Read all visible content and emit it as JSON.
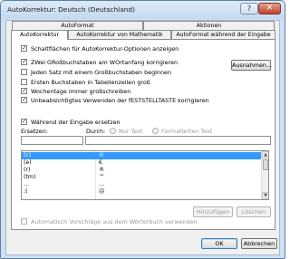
{
  "window": {
    "title": "AutoKorrektur: Deutsch (Deutschland)",
    "help_glyph": "?",
    "close_glyph": "✕"
  },
  "tabs": {
    "row1": [
      "AutoFormat",
      "Aktionen"
    ],
    "row2": [
      "AutoKorrektur",
      "AutoKorrektur von Mathematik",
      "AutoFormat während der Eingabe"
    ],
    "active": "AutoKorrektur"
  },
  "options": [
    {
      "label": "Schaltflächen für AutoKorrektur-Optionen anzeigen",
      "checked": true
    },
    {
      "label": "ZWei GRoßbuchstaben am WOrtanfang korrigieren",
      "checked": true
    },
    {
      "label": "Jeden Satz mit einem Großbuchstaben beginnen",
      "checked": false
    },
    {
      "label": "Ersten Buchstaben in Tabellenzellen groß",
      "checked": false
    },
    {
      "label": "Wochentage immer großschreiben",
      "checked": true
    },
    {
      "label": "Unbeabsichtigtes Verwenden der fESTSTELLTASTE korrigieren",
      "checked": true
    }
  ],
  "exceptions_button": "Ausnahmen...",
  "replace": {
    "label": "Während der Eingabe ersetzen",
    "checked": true,
    "replace_label": "Ersetzen:",
    "with_label": "Durch:",
    "plain_text": "Nur Text",
    "formatted_text": "Formatierten Text",
    "replace_value": "",
    "with_value": ""
  },
  "list": [
    {
      "from": "(c)",
      "to": "©",
      "selected": true
    },
    {
      "from": "(e)",
      "to": "€",
      "selected": false
    },
    {
      "from": "(r)",
      "to": "®",
      "selected": false
    },
    {
      "from": "(tm)",
      "to": "™",
      "selected": false
    },
    {
      "from": "...",
      "to": "…",
      "selected": false
    },
    {
      "from": ":(",
      "to": "☹",
      "selected": false
    }
  ],
  "buttons": {
    "add": "Hinzufügen",
    "delete": "Löschen",
    "ok": "OK",
    "cancel": "Abbrechen"
  },
  "suggestions": {
    "label": "Automatisch Vorschläge aus dem Wörterbuch verwenden",
    "checked": false
  }
}
